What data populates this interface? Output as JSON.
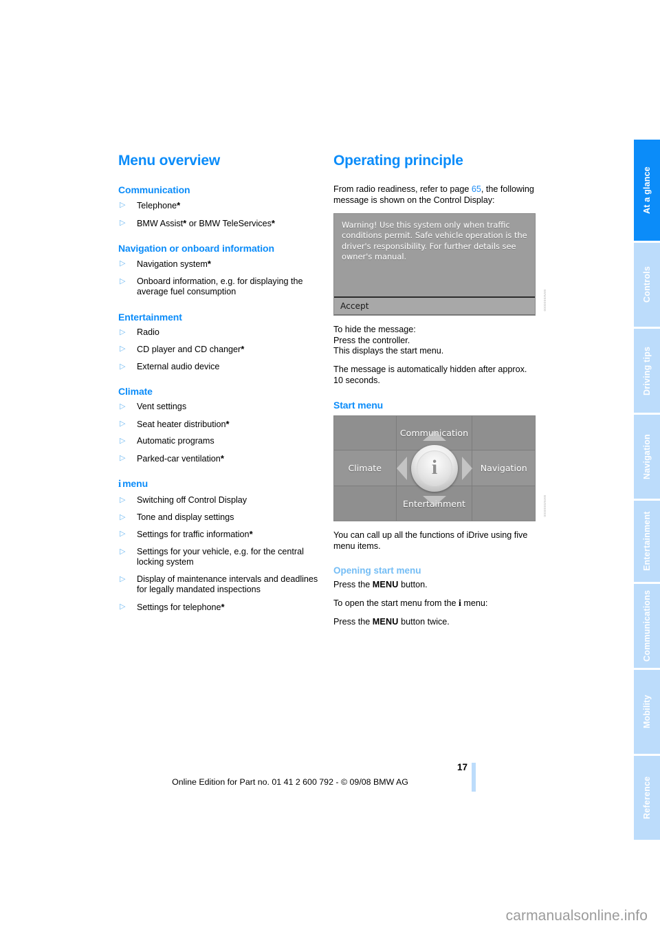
{
  "sidebar": {
    "tabs": [
      {
        "label": "At a glance",
        "active": true
      },
      {
        "label": "Controls",
        "active": false
      },
      {
        "label": "Driving tips",
        "active": false
      },
      {
        "label": "Navigation",
        "active": false
      },
      {
        "label": "Entertainment",
        "active": false
      },
      {
        "label": "Communications",
        "active": false
      },
      {
        "label": "Mobility",
        "active": false
      },
      {
        "label": "Reference",
        "active": false
      }
    ]
  },
  "left_column": {
    "chapter_title": "Menu overview",
    "sections": [
      {
        "heading": "Communication",
        "items": [
          {
            "text": "Telephone",
            "star": "*"
          },
          {
            "text": "BMW Assist",
            "star": "*",
            "text2": " or BMW TeleServices",
            "star2": "*"
          }
        ]
      },
      {
        "heading": "Navigation or onboard information",
        "items": [
          {
            "text": "Navigation system",
            "star": "*"
          },
          {
            "text": "Onboard information, e.g. for displaying the average fuel consumption",
            "star": ""
          }
        ]
      },
      {
        "heading": "Entertainment",
        "items": [
          {
            "text": "Radio",
            "star": ""
          },
          {
            "text": "CD player and CD changer",
            "star": "*"
          },
          {
            "text": "External audio device",
            "star": ""
          }
        ]
      },
      {
        "heading": "Climate",
        "items": [
          {
            "text": "Vent settings",
            "star": ""
          },
          {
            "text": "Seat heater distribution",
            "star": "*"
          },
          {
            "text": "Automatic programs",
            "star": ""
          },
          {
            "text": "Parked-car ventilation",
            "star": "*"
          }
        ]
      },
      {
        "heading_prefix_i": "i",
        "heading": "menu",
        "items": [
          {
            "text": "Switching off Control Display",
            "star": ""
          },
          {
            "text": "Tone and display settings",
            "star": ""
          },
          {
            "text": "Settings for traffic information",
            "star": "*"
          },
          {
            "text": "Settings for your vehicle, e.g. for the central locking system",
            "star": ""
          },
          {
            "text": "Display of maintenance intervals and deadlines for legally mandated inspections",
            "star": ""
          },
          {
            "text": "Settings for telephone",
            "star": "*"
          }
        ]
      }
    ],
    "bullet_marker": "triangle-right-icon"
  },
  "right_column": {
    "chapter_title": "Operating principle",
    "intro_part1": "From radio readiness, refer to page ",
    "intro_xref": "65",
    "intro_part2": ", the following message is shown on the Control Display:",
    "control_display": {
      "warning_text": "Warning! Use this system only when traffic conditions permit. Safe vehicle operation is the driver's responsibility. For further details see owner's manual.",
      "accept_button": "Accept",
      "credit": "BMW0000000"
    },
    "hide_instructions": [
      "To hide the message:",
      "Press the controller.",
      "This displays the start menu."
    ],
    "auto_hide_text": "The message is automatically hidden after approx. 10 seconds.",
    "start_menu_heading": "Start menu",
    "start_menu": {
      "top_label": "Communication",
      "left_label": "Climate",
      "right_label": "Navigation",
      "bottom_label": "Entertainment",
      "center_icon": "i",
      "credit": "BMW0000000"
    },
    "start_menu_text": "You can call up all the functions of iDrive using five menu items.",
    "opening_heading": "Opening start menu",
    "opening_line1_pre": "Press the ",
    "opening_line1_kbd": "MENU",
    "opening_line1_post": " button.",
    "opening_line2_pre": "To open the start menu from the ",
    "opening_line2_i": "i",
    "opening_line2_post": " menu:",
    "opening_line3_pre": "Press the ",
    "opening_line3_kbd": "MENU",
    "opening_line3_post": " button twice."
  },
  "footer": {
    "page_number": "17",
    "edition": "Online Edition for Part no. 01 41 2 600 792 - © 09/08 BMW AG"
  },
  "watermark": "carmanualsonline.info"
}
